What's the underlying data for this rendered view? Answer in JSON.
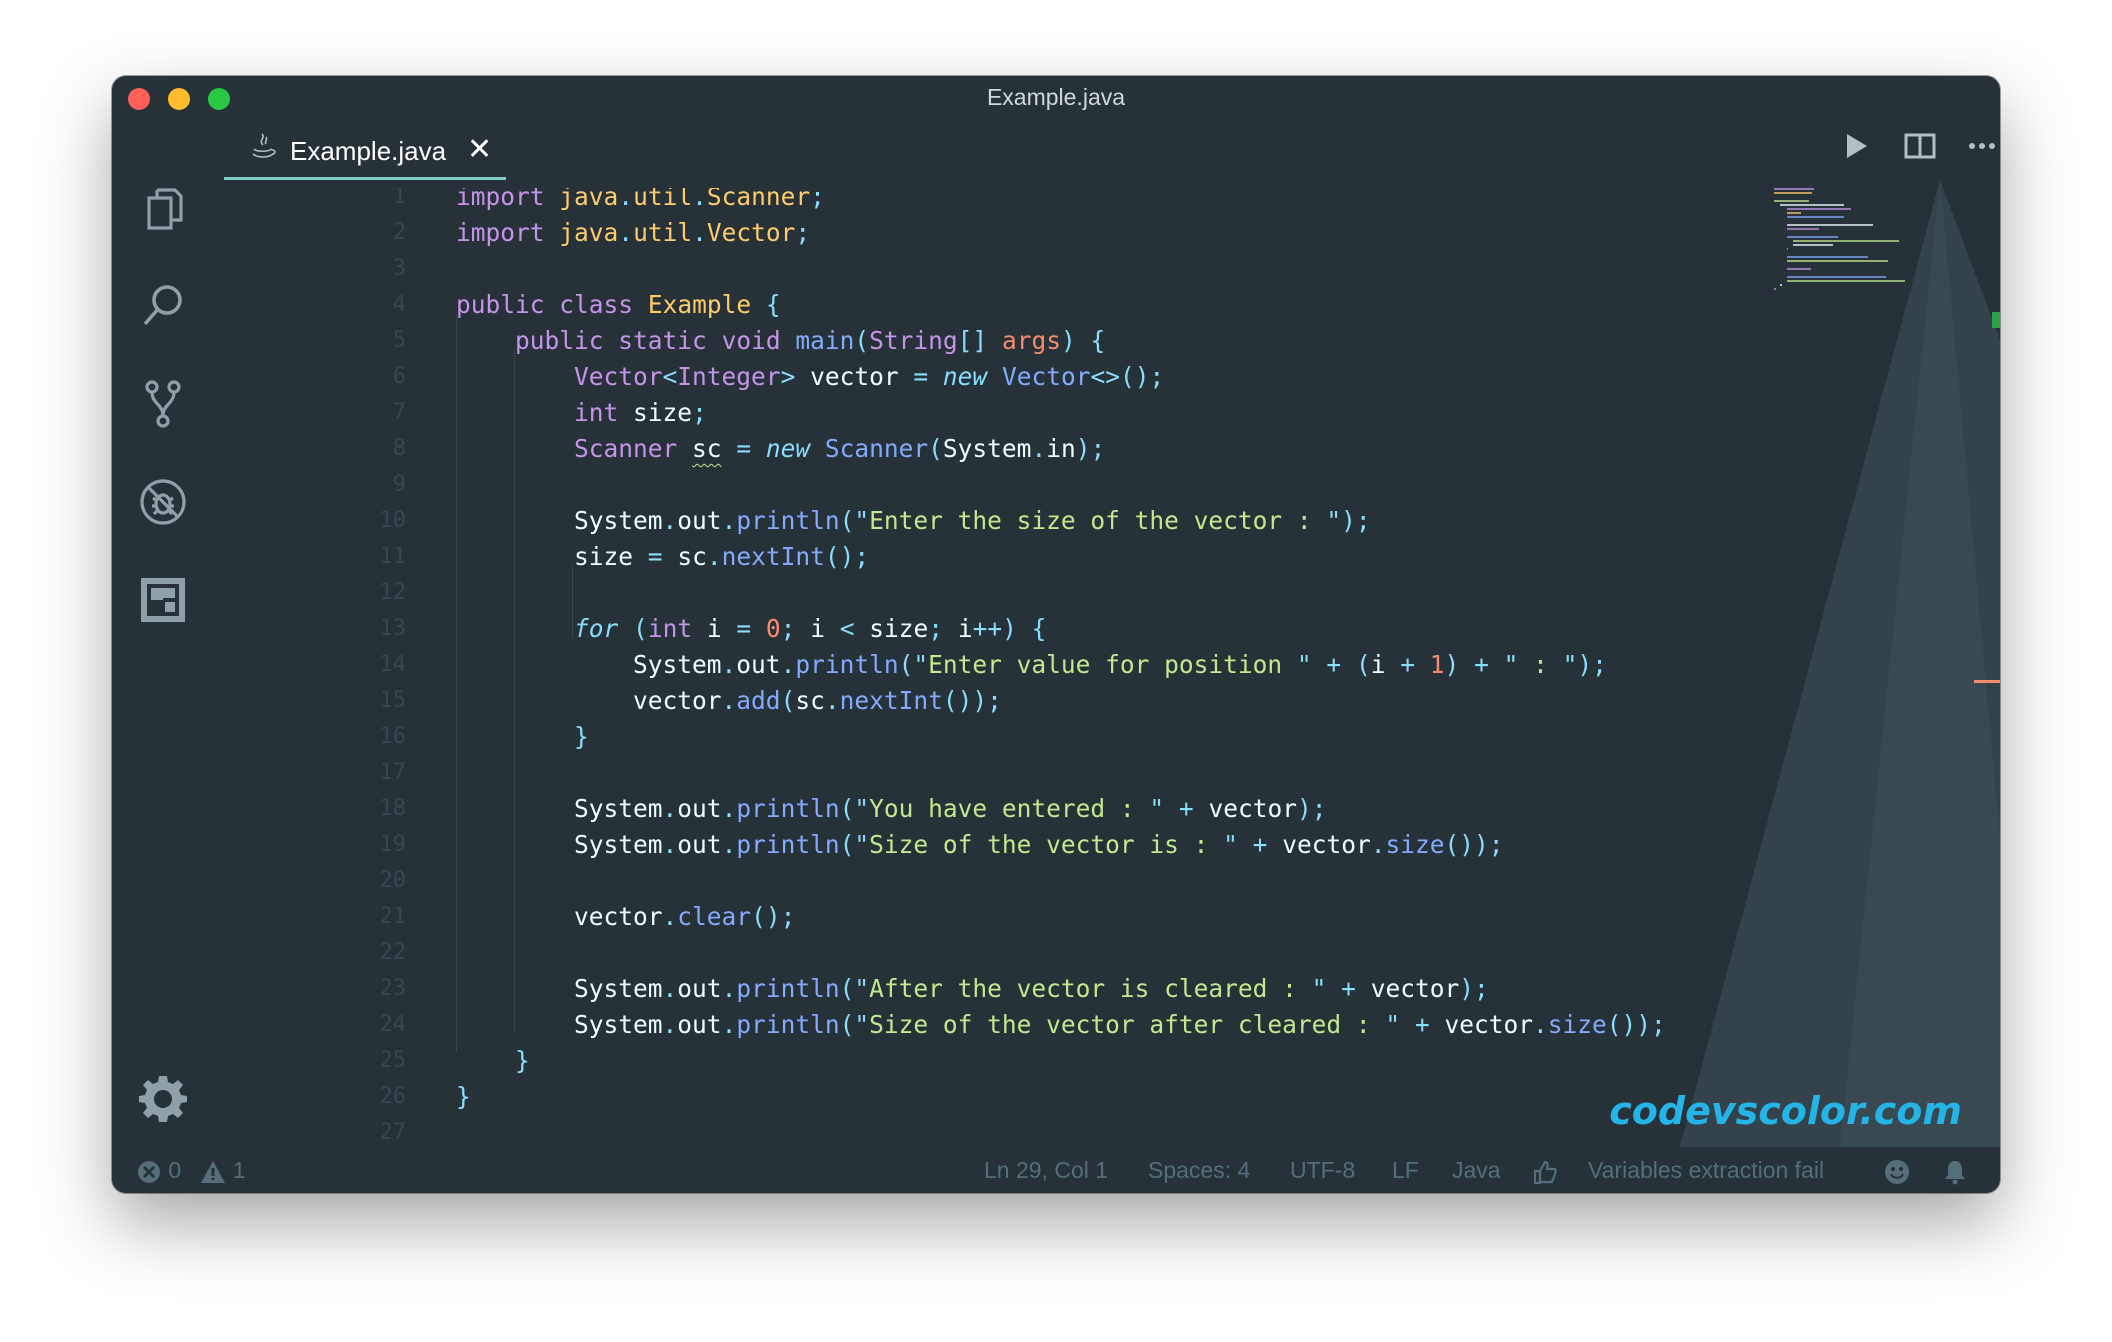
{
  "window": {
    "title": "Example.java"
  },
  "activity_bar": [
    {
      "name": "explorer-icon"
    },
    {
      "name": "search-icon"
    },
    {
      "name": "source-control-icon"
    },
    {
      "name": "debug-icon"
    },
    {
      "name": "extensions-icon"
    },
    {
      "name": "settings-gear-icon"
    }
  ],
  "tab": {
    "label": "Example.java",
    "close": "✕"
  },
  "editor_actions": [
    {
      "name": "run-icon"
    },
    {
      "name": "split-editor-icon"
    },
    {
      "name": "more-actions-icon"
    }
  ],
  "code": {
    "line_numbers": [
      "1",
      "2",
      "3",
      "4",
      "5",
      "6",
      "7",
      "8",
      "9",
      "10",
      "11",
      "12",
      "13",
      "14",
      "15",
      "16",
      "17",
      "18",
      "19",
      "20",
      "21",
      "22",
      "23",
      "24",
      "25",
      "26",
      "27"
    ],
    "lines": [
      "import java.util.Scanner;",
      "import java.util.Vector;",
      "",
      "public class Example {",
      "    public static void main(String[] args) {",
      "        Vector<Integer> vector = new Vector<>();",
      "        int size;",
      "        Scanner sc = new Scanner(System.in);",
      "",
      "        System.out.println(\"Enter the size of the vector : \");",
      "        size = sc.nextInt();",
      "",
      "        for (int i = 0; i < size; i++) {",
      "            System.out.println(\"Enter value for position \" + (i + 1) + \" : \");",
      "            vector.add(sc.nextInt());",
      "        }",
      "",
      "        System.out.println(\"You have entered : \" + vector);",
      "        System.out.println(\"Size of the vector is : \" + vector.size());",
      "",
      "        vector.clear();",
      "",
      "        System.out.println(\"After the vector is cleared : \" + vector);",
      "        System.out.println(\"Size of the vector after cleared : \" + vector.size());",
      "    }",
      "}",
      ""
    ]
  },
  "watermark": "codevscolor.com",
  "status_bar": {
    "errors": "0",
    "warnings": "1",
    "position": "Ln 29, Col 1",
    "spaces": "Spaces: 4",
    "encoding": "UTF-8",
    "eol": "LF",
    "language": "Java",
    "message": "Variables extraction fail"
  },
  "colors": {
    "editor_bg": "#263238",
    "keyword": "#c792ea",
    "type": "#ffcb6b",
    "function": "#82aaff",
    "string": "#c3e88d",
    "number": "#f78c6c",
    "punctuation": "#89ddff",
    "watermark": "#25b4e8"
  }
}
